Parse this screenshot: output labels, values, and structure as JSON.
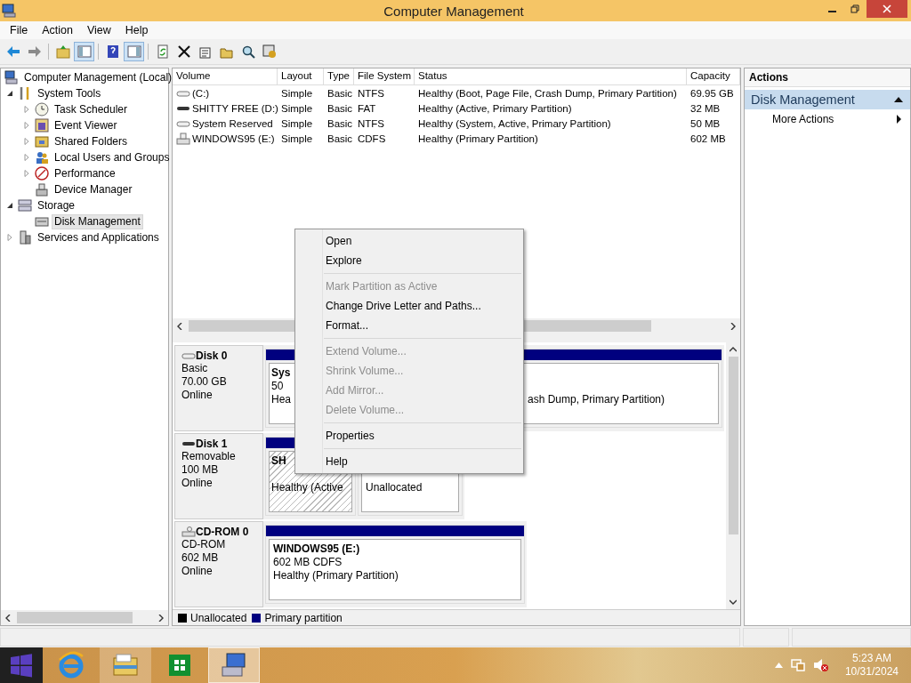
{
  "window": {
    "title": "Computer Management"
  },
  "menu": [
    "File",
    "Action",
    "View",
    "Help"
  ],
  "toolbar": [
    {
      "kind": "back",
      "pressed": false
    },
    {
      "kind": "forward",
      "pressed": false
    },
    {
      "kind": "separator"
    },
    {
      "kind": "up",
      "pressed": false
    },
    {
      "kind": "console-tree",
      "pressed": true
    },
    {
      "kind": "separator"
    },
    {
      "kind": "help",
      "pressed": false
    },
    {
      "kind": "action-pane",
      "pressed": true
    },
    {
      "kind": "separator"
    },
    {
      "kind": "refresh",
      "pressed": false
    },
    {
      "kind": "delete",
      "pressed": false
    },
    {
      "kind": "properties",
      "pressed": false
    },
    {
      "kind": "open",
      "pressed": false
    },
    {
      "kind": "find",
      "pressed": false
    },
    {
      "kind": "settings",
      "pressed": false
    }
  ],
  "tree": [
    {
      "label": "Computer Management (Local)",
      "selected": false,
      "children": [
        {
          "label": "System Tools",
          "selected": false,
          "expanded": true,
          "children": [
            {
              "label": "Task Scheduler",
              "selected": false,
              "expanded": false
            },
            {
              "label": "Event Viewer",
              "selected": false,
              "expanded": false
            },
            {
              "label": "Shared Folders",
              "selected": false,
              "expanded": false
            },
            {
              "label": "Local Users and Groups",
              "selected": false,
              "expanded": false
            },
            {
              "label": "Performance",
              "selected": false,
              "expanded": false
            },
            {
              "label": "Device Manager",
              "selected": false
            }
          ]
        },
        {
          "label": "Storage",
          "selected": false,
          "expanded": true,
          "children": [
            {
              "label": "Disk Management",
              "selected": true
            }
          ]
        },
        {
          "label": "Services and Applications",
          "selected": false,
          "expanded": false
        }
      ]
    }
  ],
  "volumes": {
    "columns": [
      "Volume",
      "Layout",
      "Type",
      "File System",
      "Status",
      "Capacity"
    ],
    "rows": [
      [
        "(C:)",
        "Simple",
        "Basic",
        "NTFS",
        "Healthy (Boot, Page File, Crash Dump, Primary Partition)",
        "69.95 GB"
      ],
      [
        "SHITTY FREE (D:)",
        "Simple",
        "Basic",
        "FAT",
        "Healthy (Active, Primary Partition)",
        "32 MB"
      ],
      [
        "System Reserved",
        "Simple",
        "Basic",
        "NTFS",
        "Healthy (System, Active, Primary Partition)",
        "50 MB"
      ],
      [
        "WINDOWS95 (E:)",
        "Simple",
        "Basic",
        "CDFS",
        "Healthy (Primary Partition)",
        "602 MB"
      ]
    ]
  },
  "disks": [
    {
      "name": "Disk 0",
      "lines": [
        "Basic",
        "70.00 GB",
        "Online"
      ],
      "partitions": [
        {
          "color": "#00007f",
          "selected": false,
          "title": "Sys",
          "lines": [
            "50",
            "Hea"
          ]
        },
        {
          "color": "#00007f",
          "selected": false,
          "lines": [
            "ash Dump, Primary Partition)"
          ]
        }
      ]
    },
    {
      "name": "Disk 1",
      "lines": [
        "Removable",
        "100 MB",
        "Online"
      ],
      "partitions": [
        {
          "color": "#00007f",
          "selected": true,
          "title": "SH",
          "lines": [
            "Healthy (Active"
          ]
        },
        {
          "selected": false,
          "lines": [
            "Unallocated"
          ]
        }
      ]
    },
    {
      "name": "CD-ROM 0",
      "lines": [
        "CD-ROM",
        "602 MB",
        "Online"
      ],
      "partitions": [
        {
          "color": "#00007f",
          "selected": false,
          "title": "WINDOWS95  (E:)",
          "lines": [
            "602 MB CDFS",
            "Healthy (Primary Partition)"
          ]
        }
      ]
    }
  ],
  "legend": [
    {
      "label": "Unallocated",
      "color": "#000000"
    },
    {
      "label": "Primary partition",
      "color": "#00007f"
    }
  ],
  "actions": {
    "title": "Actions",
    "section": "Disk Management",
    "expanded": true,
    "items": [
      "More Actions"
    ]
  },
  "context_menu": [
    {
      "kind": "item",
      "label": "Open",
      "disabled": false
    },
    {
      "kind": "item",
      "label": "Explore",
      "disabled": false
    },
    {
      "kind": "separator"
    },
    {
      "kind": "item",
      "label": "Mark Partition as Active",
      "disabled": true
    },
    {
      "kind": "item",
      "label": "Change Drive Letter and Paths...",
      "disabled": false
    },
    {
      "kind": "item",
      "label": "Format...",
      "disabled": false
    },
    {
      "kind": "separator"
    },
    {
      "kind": "item",
      "label": "Extend Volume...",
      "disabled": true
    },
    {
      "kind": "item",
      "label": "Shrink Volume...",
      "disabled": true
    },
    {
      "kind": "item",
      "label": "Add Mirror...",
      "disabled": true
    },
    {
      "kind": "item",
      "label": "Delete Volume...",
      "disabled": true
    },
    {
      "kind": "separator"
    },
    {
      "kind": "item",
      "label": "Properties",
      "disabled": false
    },
    {
      "kind": "separator"
    },
    {
      "kind": "item",
      "label": "Help",
      "disabled": false
    }
  ],
  "taskbar": {
    "apps": [
      {
        "running": false,
        "selected": false
      },
      {
        "running": true,
        "selected": false
      },
      {
        "running": false,
        "selected": false
      },
      {
        "running": true,
        "selected": true
      }
    ],
    "clock": {
      "time": "5:23 AM",
      "date": "10/31/2024"
    }
  }
}
